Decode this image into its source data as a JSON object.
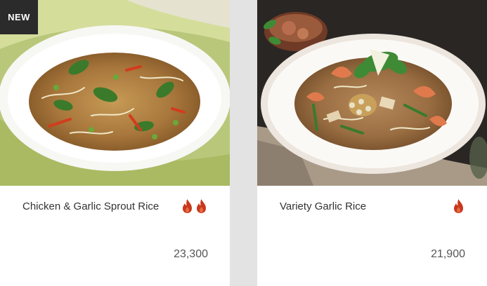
{
  "menu_items": [
    {
      "badge": "NEW",
      "name": "Chicken & Garlic Sprout Rice",
      "spice_level": 2,
      "spice_icon": "chili-flame-icon",
      "price": "23,300",
      "accent_color": "#c8381c"
    },
    {
      "badge": "",
      "name": "Variety Garlic Rice",
      "spice_level": 1,
      "spice_icon": "chili-flame-icon",
      "price": "21,900",
      "accent_color": "#c8381c"
    }
  ]
}
